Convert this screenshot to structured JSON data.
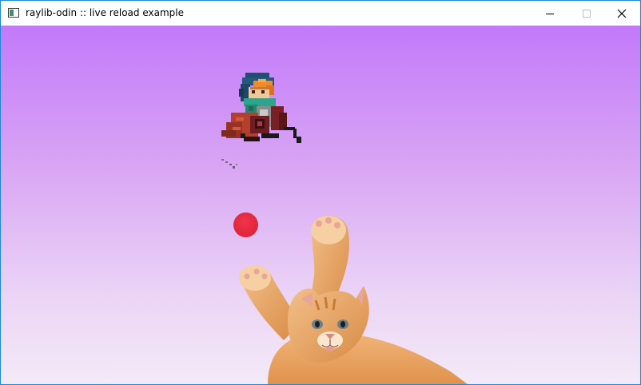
{
  "window": {
    "title": "raylib-odin :: live reload example",
    "icon": "app-window-icon",
    "controls": [
      "minimize-icon",
      "maximize-icon",
      "close-icon"
    ]
  },
  "scene": {
    "background_top": "#c279fa",
    "background_bottom": "#f4eaf7",
    "sprites": [
      "pixel-adventurer-character",
      "red-ball",
      "orange-kitten-reaching"
    ],
    "ball_color": "#e3263c"
  }
}
